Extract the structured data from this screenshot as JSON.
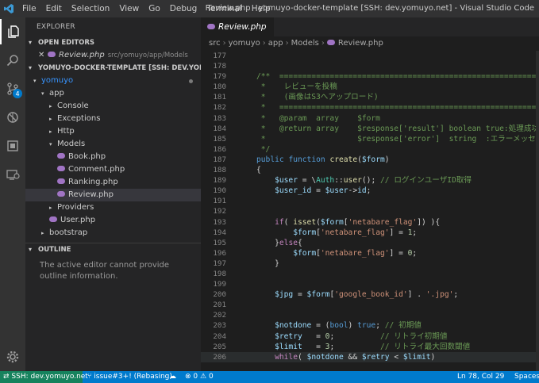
{
  "titlebar": {
    "menus": [
      "File",
      "Edit",
      "Selection",
      "View",
      "Go",
      "Debug",
      "Terminal",
      "Help"
    ],
    "window_title": "Review.php - yomuyo-docker-template [SSH: dev.yomuyo.net] - Visual Studio Code"
  },
  "activity_bar": {
    "items": [
      "explorer-icon",
      "search-icon",
      "source-control-icon",
      "debug-icon",
      "extensions-icon",
      "remote-explorer-icon",
      "settings-gear-icon"
    ],
    "source_control_badge": "4"
  },
  "sidebar": {
    "title": "EXPLORER",
    "open_editors_header": "OPEN EDITORS",
    "open_editor": {
      "name": "Review.php",
      "path": "src/yomuyo/app/Models"
    },
    "workspace_header": "YOMUYO-DOCKER-TEMPLATE [SSH: DEV.YOMUYO...",
    "tree": [
      {
        "label": "yomuyo",
        "depth": 0,
        "caret": "",
        "file": false,
        "selected": false,
        "folder_open": true,
        "color": "#3794ff"
      },
      {
        "label": "app",
        "depth": 1,
        "caret": "▾",
        "file": false,
        "selected": false
      },
      {
        "label": "Console",
        "depth": 2,
        "caret": "▸",
        "file": false,
        "selected": false
      },
      {
        "label": "Exceptions",
        "depth": 2,
        "caret": "▸",
        "file": false,
        "selected": false
      },
      {
        "label": "Http",
        "depth": 2,
        "caret": "▸",
        "file": false,
        "selected": false
      },
      {
        "label": "Models",
        "depth": 2,
        "caret": "▾",
        "file": false,
        "selected": false
      },
      {
        "label": "Book.php",
        "depth": 3,
        "caret": "",
        "file": true,
        "selected": false
      },
      {
        "label": "Comment.php",
        "depth": 3,
        "caret": "",
        "file": true,
        "selected": false
      },
      {
        "label": "Ranking.php",
        "depth": 3,
        "caret": "",
        "file": true,
        "selected": false
      },
      {
        "label": "Review.php",
        "depth": 3,
        "caret": "",
        "file": true,
        "selected": true
      },
      {
        "label": "Providers",
        "depth": 2,
        "caret": "▸",
        "file": false,
        "selected": false
      },
      {
        "label": "User.php",
        "depth": 2,
        "caret": "",
        "file": true,
        "selected": false
      },
      {
        "label": "bootstrap",
        "depth": 1,
        "caret": "▸",
        "file": false,
        "selected": false
      }
    ],
    "outline_header": "OUTLINE",
    "outline_message": "The active editor cannot provide outline information."
  },
  "editor": {
    "tab_label": "Review.php",
    "breadcrumb": [
      "src",
      "yomuyo",
      "app",
      "Models",
      "Review.php"
    ],
    "lines": [
      {
        "n": "177",
        "html": ""
      },
      {
        "n": "178",
        "html": ""
      },
      {
        "n": "179",
        "html": "<span class='c-cm'>/**  ================================================================</span>"
      },
      {
        "n": "180",
        "html": "<span class='c-cm'> *    レビューを投稿</span>"
      },
      {
        "n": "181",
        "html": "<span class='c-cm'> *    (画像はS3へアップロード)</span>"
      },
      {
        "n": "182",
        "html": "<span class='c-cm'> *   ================================================================</span>"
      },
      {
        "n": "183",
        "html": "<span class='c-cm'> *   @param  array    $form</span>"
      },
      {
        "n": "184",
        "html": "<span class='c-cm'> *   @return array    $response['result'] boolean true:処理成功 f</span>"
      },
      {
        "n": "185",
        "html": "<span class='c-cm'> *                    $response['error']  string  :エラーメッセー</span>"
      },
      {
        "n": "186",
        "html": "<span class='c-cm'> */</span>"
      },
      {
        "n": "187",
        "html": "<span class='c-kw'>public</span> <span class='c-kw'>function</span> <span class='c-fn'>create</span>(<span class='c-var'>$form</span>)"
      },
      {
        "n": "188",
        "html": "{"
      },
      {
        "n": "189",
        "html": "    <span class='c-var'>$user</span> = \\<span class='c-ty'>Auth</span>::<span class='c-fn'>user</span>(); <span class='c-cm'>// ログインユーザID取得</span>"
      },
      {
        "n": "190",
        "html": "    <span class='c-var'>$user_id</span> = <span class='c-var'>$user</span>-><span class='c-var'>id</span>;"
      },
      {
        "n": "191",
        "html": ""
      },
      {
        "n": "192",
        "html": ""
      },
      {
        "n": "193",
        "html": "    <span class='c-ctl'>if</span>( <span class='c-fn'>isset</span>(<span class='c-var'>$form</span>[<span class='c-str'>'netabare_flag'</span>]) ){"
      },
      {
        "n": "194",
        "html": "        <span class='c-var'>$form</span>[<span class='c-str'>'netabare_flag'</span>] = <span class='c-num'>1</span>;"
      },
      {
        "n": "195",
        "html": "    }<span class='c-ctl'>else</span>{"
      },
      {
        "n": "196",
        "html": "        <span class='c-var'>$form</span>[<span class='c-str'>'netabare_flag'</span>] = <span class='c-num'>0</span>;"
      },
      {
        "n": "197",
        "html": "    }"
      },
      {
        "n": "198",
        "html": ""
      },
      {
        "n": "199",
        "html": ""
      },
      {
        "n": "200",
        "html": "    <span class='c-var'>$jpg</span> = <span class='c-var'>$form</span>[<span class='c-str'>'google_book_id'</span>] . <span class='c-str'>'.jpg'</span>;"
      },
      {
        "n": "201",
        "html": ""
      },
      {
        "n": "202",
        "html": ""
      },
      {
        "n": "203",
        "html": "    <span class='c-var'>$notdone</span> = (<span class='c-kw'>bool</span>) <span class='c-kw'>true</span>; <span class='c-cm'>// 初期値</span>"
      },
      {
        "n": "204",
        "html": "    <span class='c-var'>$retry</span>   = <span class='c-num'>0</span>;          <span class='c-cm'>// リトライ初期値</span>"
      },
      {
        "n": "205",
        "html": "    <span class='c-var'>$limit</span>   = <span class='c-num'>3</span>;          <span class='c-cm'>// リトライ最大回数閾値</span>"
      },
      {
        "n": "206",
        "html": "    <span class='c-ctl'>while</span>( <span class='c-var'>$notdone</span> && <span class='c-var'>$retry</span> < <span class='c-var'>$limit</span>)"
      }
    ]
  },
  "statusbar": {
    "remote": "SSH: dev.yomuyo.net",
    "branch": "issue#3+! (Rebasing)",
    "errors": "0",
    "warnings": "0",
    "cursor": "Ln 78, Col 29",
    "indent": "Spaces"
  },
  "colors": {
    "accent": "#007acc",
    "remote": "#16825d",
    "php_icon": "#a074c4"
  }
}
